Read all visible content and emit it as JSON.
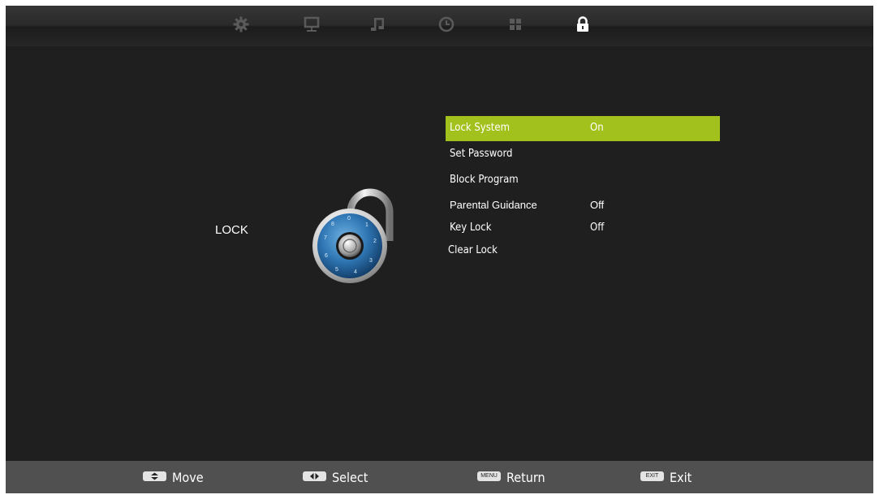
{
  "tabs": [
    {
      "name": "picture-settings-icon",
      "active": false
    },
    {
      "name": "screen-icon",
      "active": false
    },
    {
      "name": "sound-icon",
      "active": false
    },
    {
      "name": "time-icon",
      "active": false
    },
    {
      "name": "apps-grid-icon",
      "active": false
    },
    {
      "name": "lock-icon",
      "active": true
    }
  ],
  "section": {
    "title": "LOCK"
  },
  "menu": {
    "items": [
      {
        "label": "Lock System",
        "value": "On"
      },
      {
        "label": "Set Password",
        "value": ""
      },
      {
        "label": "Block Program",
        "value": ""
      },
      {
        "label": "Parental Guidance",
        "value": "Off"
      },
      {
        "label": "Key Lock",
        "value": "Off"
      },
      {
        "label": "Clear Lock",
        "value": ""
      }
    ]
  },
  "footer": {
    "move": {
      "key": "",
      "label": "Move"
    },
    "select": {
      "key": "",
      "label": "Select"
    },
    "return": {
      "key": "MENU",
      "label": "Return"
    },
    "exit": {
      "key": "EXIT",
      "label": "Exit"
    }
  },
  "colors": {
    "highlight": "#a3c11d",
    "background": "#1f1f1f",
    "footer": "#505050"
  }
}
